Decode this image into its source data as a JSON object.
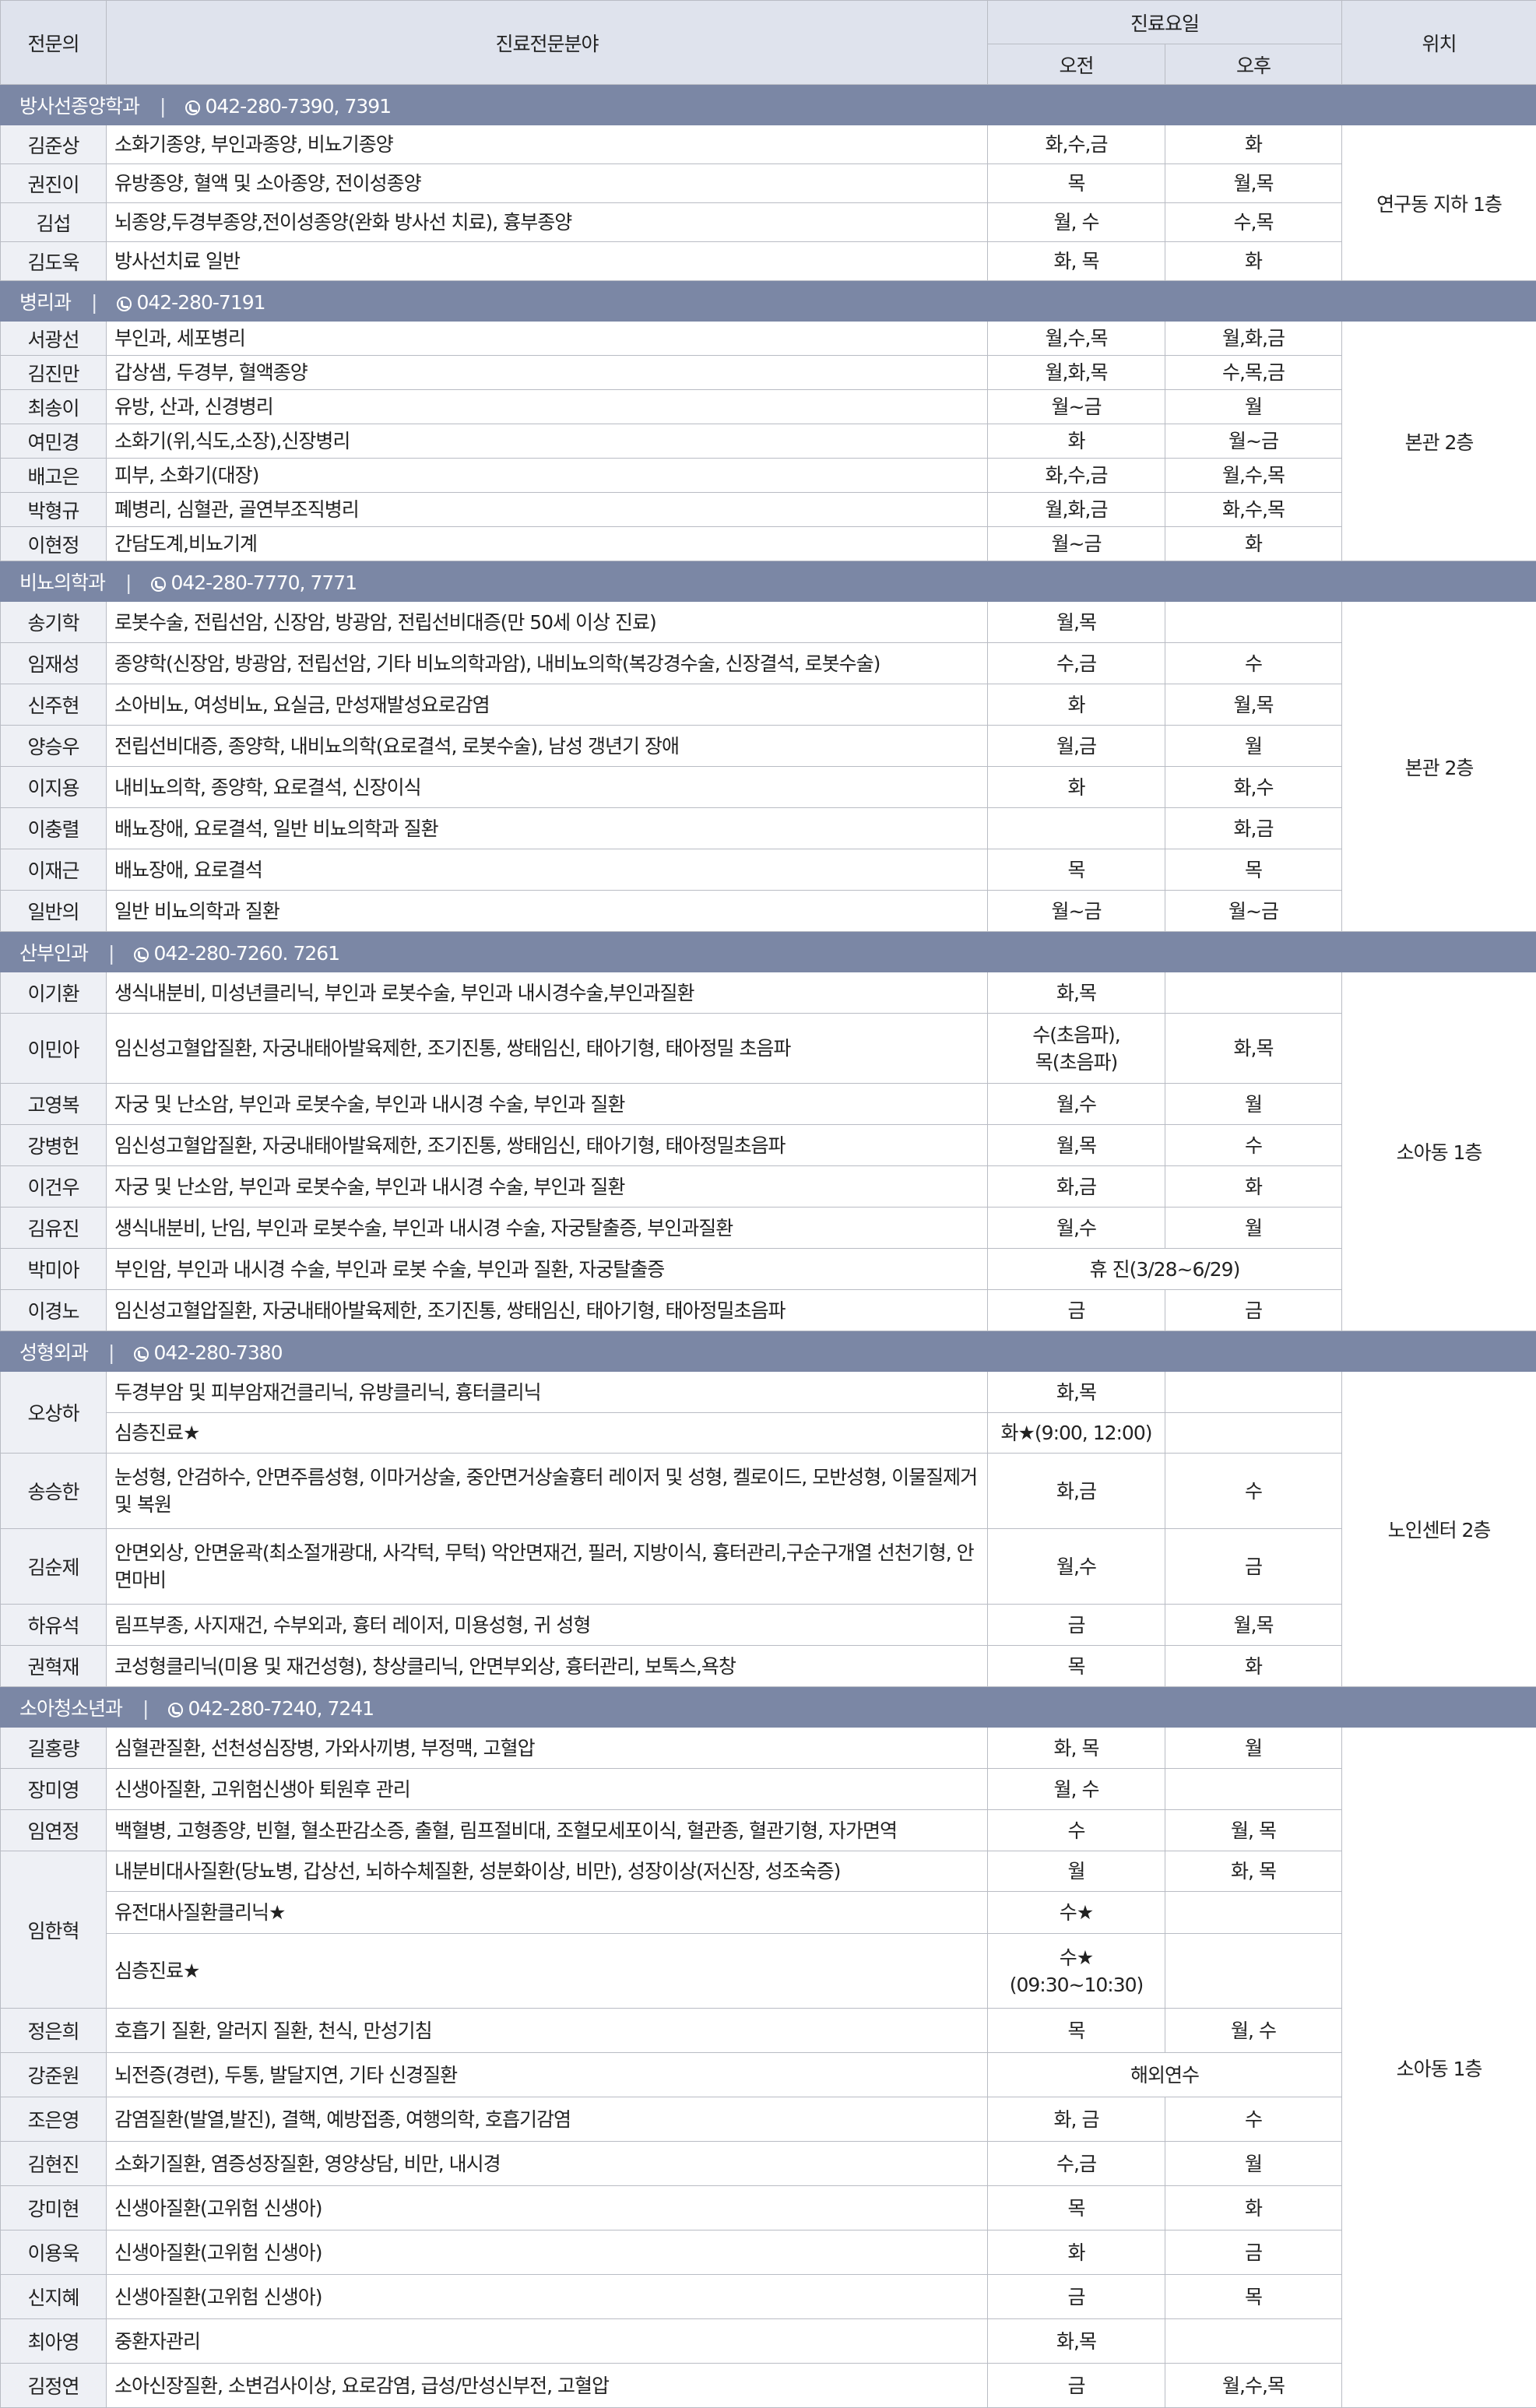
{
  "header": {
    "doctor": "전문의",
    "specialty": "진료전문분야",
    "days": "진료요일",
    "am": "오전",
    "pm": "오후",
    "location": "위치"
  },
  "departments": [
    {
      "name": "방사선종양학과",
      "phone": "042-280-7390, 7391",
      "location": "연구동 지하 1층",
      "doctors": [
        {
          "name": "김준상",
          "rows": [
            {
              "specialty": "소화기종양, 부인과종양, 비뇨기종양",
              "am": "화,수,금",
              "pm": "화"
            }
          ]
        },
        {
          "name": "권진이",
          "rows": [
            {
              "specialty": "유방종양, 혈액 및 소아종양, 전이성종양",
              "am": "목",
              "pm": "월,목"
            }
          ]
        },
        {
          "name": "김섭",
          "rows": [
            {
              "specialty": "뇌종양,두경부종양,전이성종양(완화 방사선 치료), 흉부종양",
              "am": "월, 수",
              "pm": "수,목"
            }
          ]
        },
        {
          "name": "김도욱",
          "rows": [
            {
              "specialty": "방사선치료 일반",
              "am": "화, 목",
              "pm": "화"
            }
          ]
        }
      ]
    },
    {
      "name": "병리과",
      "phone": "042-280-7191",
      "location": "본관 2층",
      "doctors": [
        {
          "name": "서광선",
          "rows": [
            {
              "specialty": "부인과, 세포병리",
              "am": "월,수,목",
              "pm": "월,화,금"
            }
          ]
        },
        {
          "name": "김진만",
          "rows": [
            {
              "specialty": "갑상샘, 두경부, 혈액종양",
              "am": "월,화,목",
              "pm": "수,목,금"
            }
          ]
        },
        {
          "name": "최송이",
          "rows": [
            {
              "specialty": "유방, 산과, 신경병리",
              "am": "월~금",
              "pm": "월"
            }
          ]
        },
        {
          "name": "여민경",
          "rows": [
            {
              "specialty": "소화기(위,식도,소장),신장병리",
              "am": "화",
              "pm": "월~금"
            }
          ]
        },
        {
          "name": "배고은",
          "rows": [
            {
              "specialty": "피부, 소화기(대장)",
              "am": "화,수,금",
              "pm": "월,수,목"
            }
          ]
        },
        {
          "name": "박형규",
          "rows": [
            {
              "specialty": "폐병리, 심혈관, 골연부조직병리",
              "am": "월,화,금",
              "pm": "화,수,목"
            }
          ]
        },
        {
          "name": "이현정",
          "rows": [
            {
              "specialty": "간담도계,비뇨기계",
              "am": "월~금",
              "pm": "화"
            }
          ]
        }
      ]
    },
    {
      "name": "비뇨의학과",
      "phone": "042-280-7770, 7771",
      "location": "본관 2층",
      "doctors": [
        {
          "name": "송기학",
          "rows": [
            {
              "specialty": "로봇수술, 전립선암, 신장암, 방광암, 전립선비대증(만 50세 이상 진료)",
              "am": "월,목",
              "pm": ""
            }
          ]
        },
        {
          "name": "임재성",
          "rows": [
            {
              "specialty": "종양학(신장암, 방광암, 전립선암, 기타 비뇨의학과암), 내비뇨의학(복강경수술, 신장결석, 로봇수술)",
              "am": "수,금",
              "pm": "수"
            }
          ]
        },
        {
          "name": "신주현",
          "rows": [
            {
              "specialty": "소아비뇨, 여성비뇨, 요실금, 만성재발성요로감염",
              "am": "화",
              "pm": "월,목"
            }
          ]
        },
        {
          "name": "양승우",
          "rows": [
            {
              "specialty": "전립선비대증, 종양학, 내비뇨의학(요로결석, 로봇수술), 남성 갱년기 장애",
              "am": "월,금",
              "pm": "월"
            }
          ]
        },
        {
          "name": "이지용",
          "rows": [
            {
              "specialty": "내비뇨의학, 종양학, 요로결석, 신장이식",
              "am": "화",
              "pm": "화,수"
            }
          ]
        },
        {
          "name": "이충렬",
          "rows": [
            {
              "specialty": "배뇨장애, 요로결석, 일반 비뇨의학과 질환",
              "am": "",
              "pm": "화,금"
            }
          ]
        },
        {
          "name": "이재근",
          "rows": [
            {
              "specialty": "배뇨장애, 요로결석",
              "am": "목",
              "pm": "목"
            }
          ]
        },
        {
          "name": "일반의",
          "rows": [
            {
              "specialty": "일반 비뇨의학과 질환",
              "am": "월~금",
              "pm": "월~금"
            }
          ]
        }
      ]
    },
    {
      "name": "산부인과",
      "phone": "042-280-7260. 7261",
      "location": "소아동 1층",
      "doctors": [
        {
          "name": "이기환",
          "rows": [
            {
              "specialty": "생식내분비, 미성년클리닉, 부인과 로봇수술, 부인과 내시경수술,부인과질환",
              "am": "화,목",
              "pm": ""
            }
          ]
        },
        {
          "name": "이민아",
          "rows": [
            {
              "specialty": "임신성고혈압질환, 자궁내태아발육제한, 조기진통, 쌍태임신, 태아기형, 태아정밀 초음파",
              "am": "수(초음파),\n목(초음파)",
              "pm": "화,목"
            }
          ]
        },
        {
          "name": "고영복",
          "rows": [
            {
              "specialty": "자궁 및 난소암, 부인과 로봇수술, 부인과 내시경 수술, 부인과 질환",
              "am": "월,수",
              "pm": "월"
            }
          ]
        },
        {
          "name": "강병헌",
          "rows": [
            {
              "specialty": "임신성고혈압질환, 자궁내태아발육제한, 조기진통, 쌍태임신, 태아기형, 태아정밀초음파",
              "am": "월,목",
              "pm": "수"
            }
          ]
        },
        {
          "name": "이건우",
          "rows": [
            {
              "specialty": "자궁 및 난소암, 부인과 로봇수술, 부인과 내시경 수술, 부인과 질환",
              "am": "화,금",
              "pm": "화"
            }
          ]
        },
        {
          "name": "김유진",
          "rows": [
            {
              "specialty": "생식내분비, 난임, 부인과 로봇수술, 부인과 내시경 수술, 자궁탈출증, 부인과질환",
              "am": "월,수",
              "pm": "월"
            }
          ]
        },
        {
          "name": "박미아",
          "rows": [
            {
              "specialty": "부인암, 부인과 내시경 수술, 부인과 로봇 수술, 부인과 질환, 자궁탈출증",
              "merged": "휴 진(3/28~6/29)"
            }
          ]
        },
        {
          "name": "이경노",
          "rows": [
            {
              "specialty": "임신성고혈압질환, 자궁내태아발육제한, 조기진통, 쌍태임신, 태아기형, 태아정밀초음파",
              "am": "금",
              "pm": "금"
            }
          ]
        }
      ]
    },
    {
      "name": "성형외과",
      "phone": "042-280-7380",
      "location": "노인센터 2층",
      "doctors": [
        {
          "name": "오상하",
          "rows": [
            {
              "specialty": "두경부암 및 피부암재건클리닉, 유방클리닉, 흉터클리닉",
              "am": "화,목",
              "pm": ""
            },
            {
              "specialty": "심층진료★",
              "am": "화★(9:00, 12:00)",
              "pm": ""
            }
          ]
        },
        {
          "name": "송승한",
          "rows": [
            {
              "specialty": "눈성형, 안검하수, 안면주름성형, 이마거상술, 중안면거상술흉터 레이저 및 성형, 켈로이드, 모반성형, 이물질제거 및 복원",
              "am": "화,금",
              "pm": "수"
            }
          ]
        },
        {
          "name": "김순제",
          "rows": [
            {
              "specialty": "안면외상, 안면윤곽(최소절개광대, 사각턱, 무턱) 악안면재건, 필러, 지방이식, 흉터관리,구순구개열 선천기형, 안면마비",
              "am": "월,수",
              "pm": "금"
            }
          ]
        },
        {
          "name": "하유석",
          "rows": [
            {
              "specialty": "림프부종, 사지재건, 수부외과, 흉터 레이저, 미용성형, 귀 성형",
              "am": "금",
              "pm": "월,목"
            }
          ]
        },
        {
          "name": "권혁재",
          "rows": [
            {
              "specialty": "코성형클리닉(미용 및 재건성형), 창상클리닉, 안면부외상, 흉터관리, 보톡스,욕창",
              "am": "목",
              "pm": "화"
            }
          ]
        }
      ]
    },
    {
      "name": "소아청소년과",
      "phone": "042-280-7240, 7241",
      "location": "소아동 1층",
      "doctors": [
        {
          "name": "길홍량",
          "rows": [
            {
              "specialty": "심혈관질환, 선천성심장병, 가와사끼병, 부정맥, 고혈압",
              "am": "화, 목",
              "pm": "월"
            }
          ]
        },
        {
          "name": "장미영",
          "rows": [
            {
              "specialty": "신생아질환, 고위험신생아 퇴원후 관리",
              "am": "월, 수",
              "pm": ""
            }
          ]
        },
        {
          "name": "임연정",
          "rows": [
            {
              "specialty": "백혈병, 고형종양, 빈혈, 혈소판감소증, 출혈, 림프절비대, 조혈모세포이식, 혈관종, 혈관기형, 자가면역",
              "am": "수",
              "pm": "월, 목"
            }
          ]
        },
        {
          "name": "임한혁",
          "rows": [
            {
              "specialty": "내분비대사질환(당뇨병, 갑상선, 뇌하수체질환, 성분화이상, 비만), 성장이상(저신장, 성조숙증)",
              "am": "월",
              "pm": "화, 목"
            },
            {
              "specialty": "유전대사질환클리닉★",
              "am": "수★",
              "pm": ""
            },
            {
              "specialty": "심층진료★",
              "am": "수★\n(09:30~10:30)",
              "pm": ""
            }
          ]
        },
        {
          "name": "정은희",
          "rows": [
            {
              "specialty": "호흡기 질환, 알러지 질환, 천식, 만성기침",
              "am": "목",
              "pm": "월, 수"
            }
          ]
        },
        {
          "name": "강준원",
          "rows": [
            {
              "specialty": "뇌전증(경련), 두통, 발달지연, 기타 신경질환",
              "merged": "해외연수"
            }
          ]
        },
        {
          "name": "조은영",
          "rows": [
            {
              "specialty": "감염질환(발열,발진), 결핵, 예방접종, 여행의학, 호흡기감염",
              "am": "화, 금",
              "pm": "수"
            }
          ]
        },
        {
          "name": "김현진",
          "rows": [
            {
              "specialty": "소화기질환, 염증성장질환, 영양상담, 비만, 내시경",
              "am": "수,금",
              "pm": "월"
            }
          ]
        },
        {
          "name": "강미현",
          "rows": [
            {
              "specialty": "신생아질환(고위험 신생아)",
              "am": "목",
              "pm": "화"
            }
          ]
        },
        {
          "name": "이용욱",
          "rows": [
            {
              "specialty": "신생아질환(고위험 신생아)",
              "am": "화",
              "pm": "금"
            }
          ]
        },
        {
          "name": "신지혜",
          "rows": [
            {
              "specialty": "신생아질환(고위험 신생아)",
              "am": "금",
              "pm": "목"
            }
          ]
        },
        {
          "name": "최아영",
          "rows": [
            {
              "specialty": "중환자관리",
              "am": "화,목",
              "pm": ""
            }
          ]
        },
        {
          "name": "김정연",
          "rows": [
            {
              "specialty": "소아신장질환, 소변검사이상, 요로감염, 급성/만성신부전, 고혈압",
              "am": "금",
              "pm": "월,수,목"
            }
          ]
        }
      ]
    }
  ]
}
